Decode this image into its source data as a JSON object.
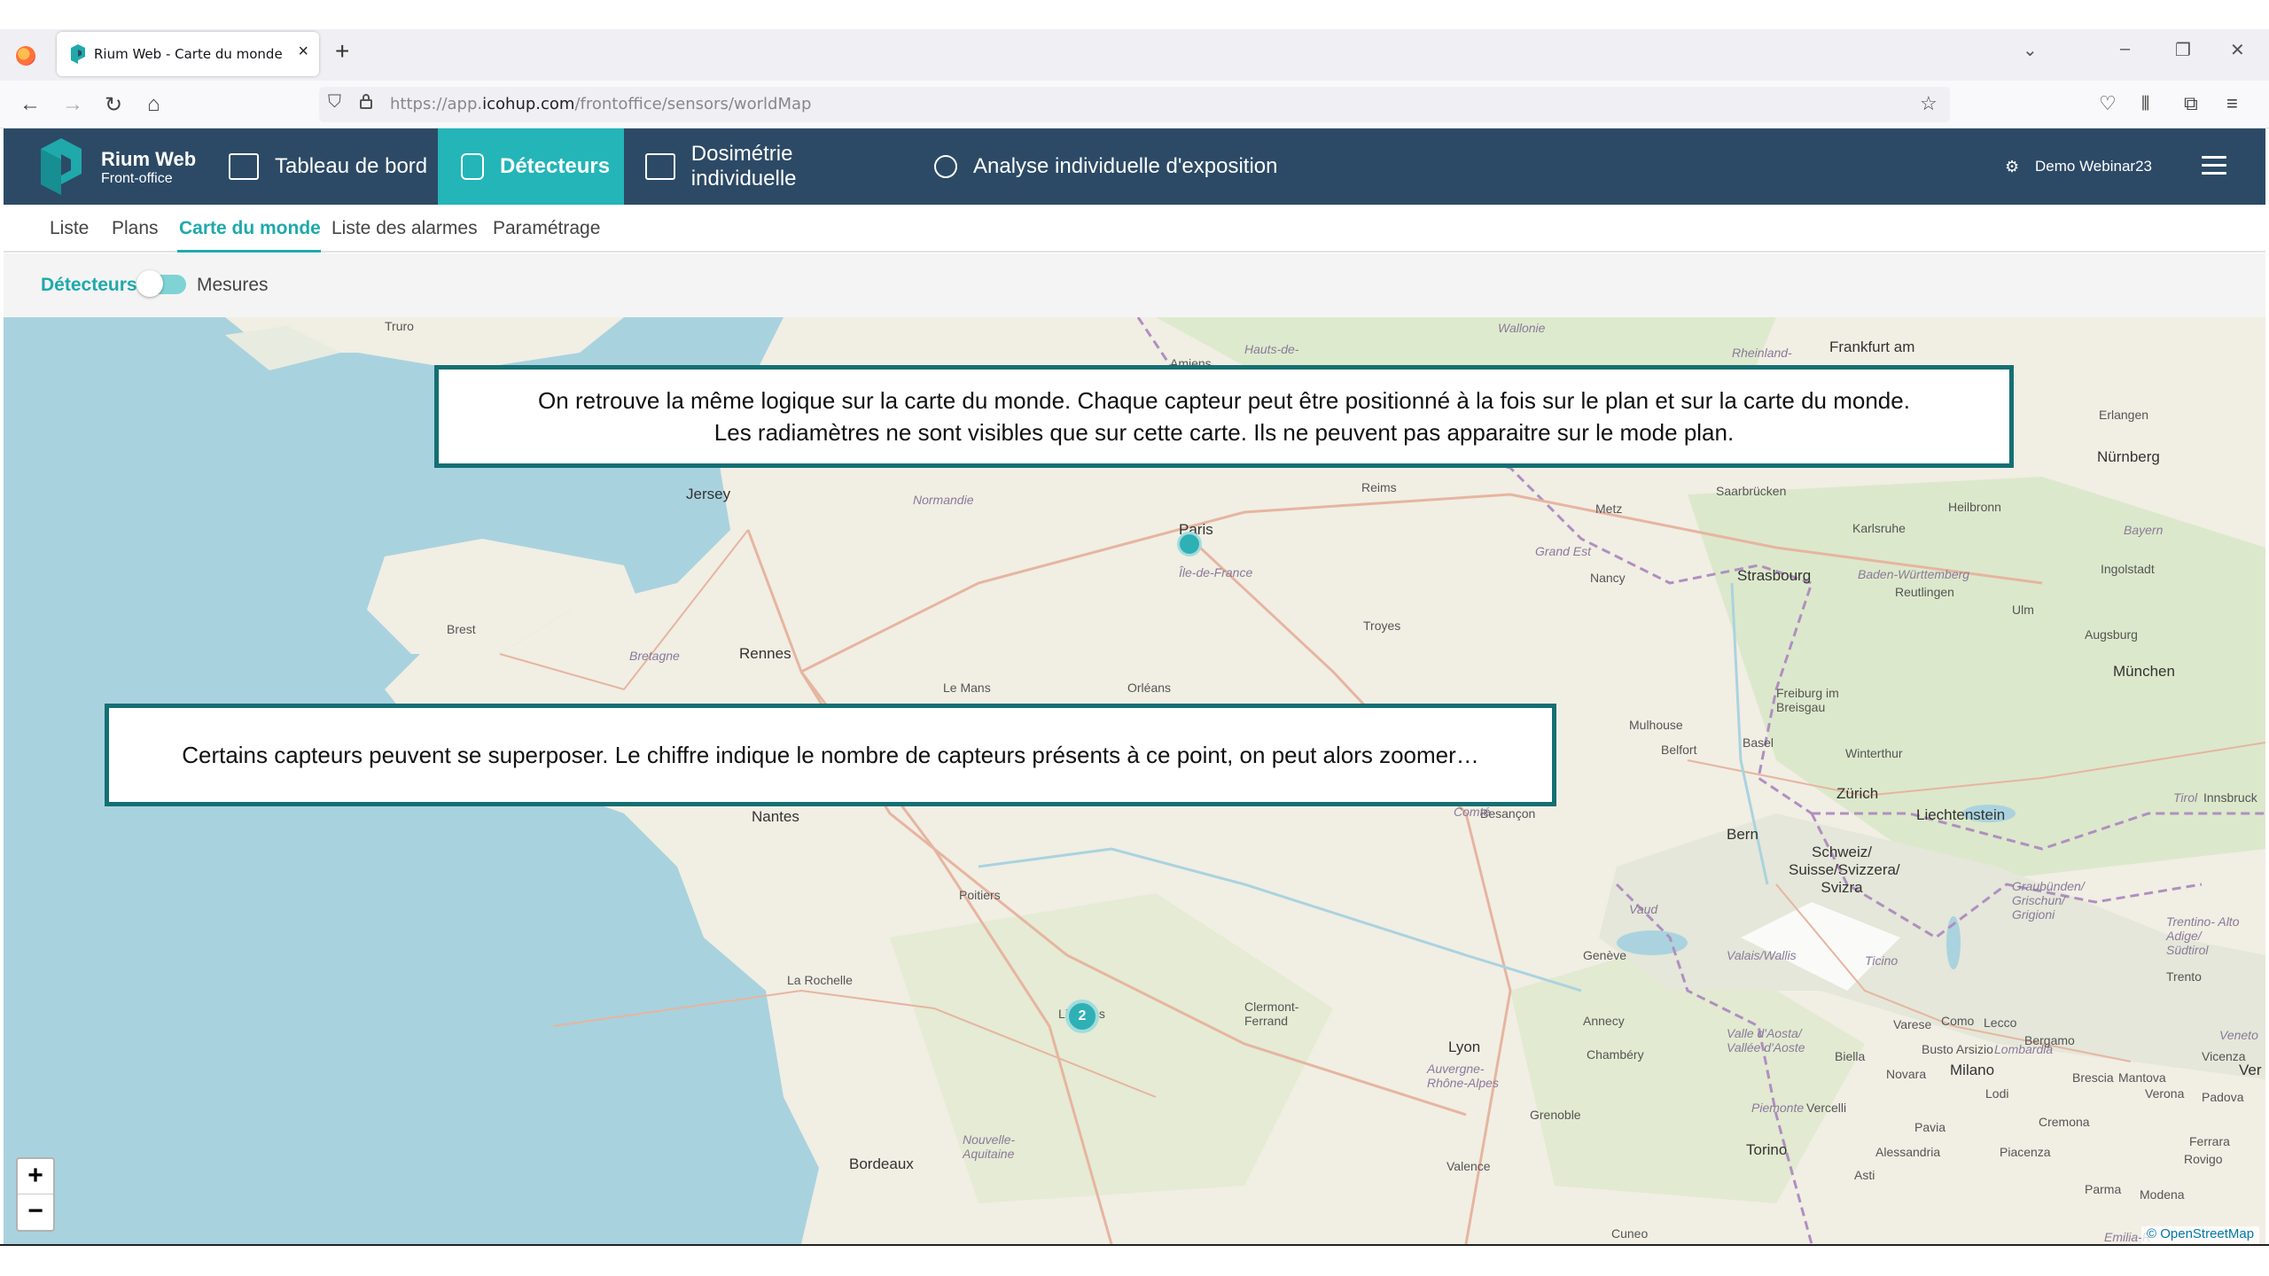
{
  "browser": {
    "tab_title": "Rium Web - Carte du monde",
    "url_prefix": "https://app.",
    "url_domain": "icohup.com",
    "url_path": "/frontoffice/sensors/worldMap"
  },
  "app": {
    "brand_name": "Rium Web",
    "brand_sub": "Front-office",
    "menu": [
      {
        "label": "Tableau de bord",
        "icon": "dashboard-icon"
      },
      {
        "label": "Détecteurs",
        "icon": "detector-icon"
      },
      {
        "label": "Dosimétrie individuelle",
        "icon": "id-card-icon"
      },
      {
        "label": "Analyse individuelle d'exposition",
        "icon": "user-search-icon"
      }
    ],
    "user": "Demo Webinar23",
    "accent": "#23b5b7",
    "header_bg": "#2c4a66"
  },
  "subnav": [
    "Liste",
    "Plans",
    "Carte du monde",
    "Liste des alarmes",
    "Paramétrage"
  ],
  "toggle": {
    "left": "Détecteurs",
    "right": "Mesures"
  },
  "map": {
    "places": [
      "Truro",
      "Jersey",
      "Brest",
      "Bretagne",
      "Rennes",
      "Normandie",
      "Paris",
      "Île-de-France",
      "Le Mans",
      "Orléans",
      "Reims",
      "Troyes",
      "Metz",
      "Nancy",
      "Grand Est",
      "Strasbourg",
      "Karlsruhe",
      "Saarbrücken",
      "Heilbronn",
      "Baden-Württemberg",
      "Reutlingen",
      "Ulm",
      "Ingolstadt",
      "Augsburg",
      "München",
      "Nürnberg",
      "Erlangen",
      "Bayern",
      "Frankfurt am",
      "Wallonie",
      "Rheinland-",
      "Hauts-de-",
      "Amiens",
      "Mulhouse",
      "Belfort",
      "Freiburg im Breisgau",
      "Basel",
      "Winterthur",
      "Zürich",
      "Liechtenstein",
      "Tirol",
      "Innsbruck",
      "Nantes",
      "Poitiers",
      "La Rochelle",
      "Limoges",
      "Clermont-Ferrand",
      "Lyon",
      "Auvergne-Rhône-Alpes",
      "Grenoble",
      "Valence",
      "Bordeaux",
      "Nouvelle-Aquitaine",
      "Besançon",
      "Comté",
      "Bern",
      "Schweiz/ Suisse/Svizzera/ Svizra",
      "Genève",
      "Vaud",
      "Valais/Wallis",
      "Ticino",
      "Annecy",
      "Chambéry",
      "Valle d'Aosta/ Vallée d'Aoste",
      "Biella",
      "Varese",
      "Como",
      "Lecco",
      "Busto Arsizio",
      "Lombardia",
      "Novara",
      "Milano",
      "Brescia",
      "Bergamo",
      "Lodi",
      "Cremona",
      "Mantova",
      "Verona",
      "Vicenza",
      "Padova",
      "Veneto",
      "Trento",
      "Trentino- Alto Adige/ Südtirol",
      "Graubünden/ Grischun/ Grigioni",
      "Piemonte",
      "Vercelli",
      "Torino",
      "Alessandria",
      "Asti",
      "Pavia",
      "Piacenza",
      "Parma",
      "Modena",
      "Rovigo",
      "Ferrara",
      "Cuneo",
      "Emilia-R",
      "Ver"
    ],
    "cluster_count": "2",
    "attribution": "© OpenStreetMap"
  },
  "callouts": {
    "top_line1": "On retrouve la même logique sur la carte du monde. Chaque capteur peut être positionné à la fois sur le plan et sur la carte du monde.",
    "top_line2": "Les radiamètres ne sont visibles que sur cette carte. Ils ne peuvent pas apparaitre sur le mode plan.",
    "middle": "Certains capteurs peuvent se superposer. Le chiffre indique le nombre de capteurs présents à ce point, on peut alors zoomer…"
  },
  "zoom": {
    "plus": "+",
    "minus": "−"
  }
}
